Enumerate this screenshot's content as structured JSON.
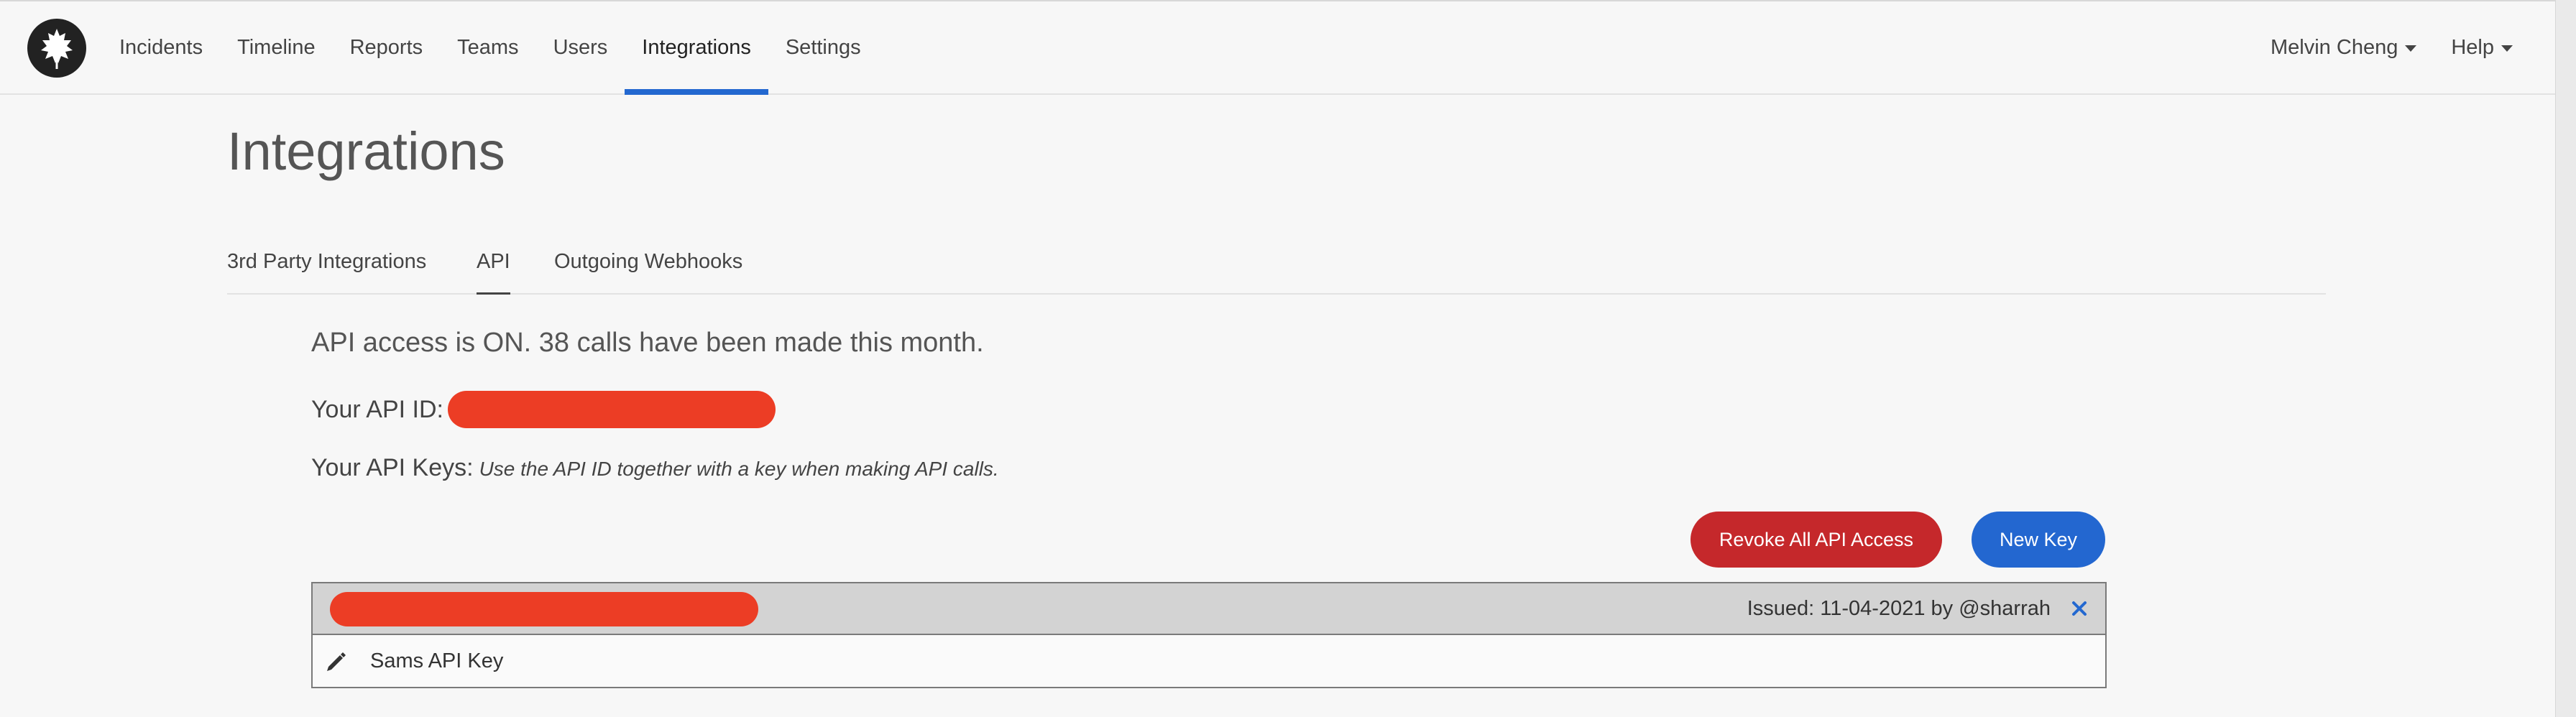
{
  "nav": {
    "items": [
      {
        "label": "Incidents",
        "active": false
      },
      {
        "label": "Timeline",
        "active": false
      },
      {
        "label": "Reports",
        "active": false
      },
      {
        "label": "Teams",
        "active": false
      },
      {
        "label": "Users",
        "active": false
      },
      {
        "label": "Integrations",
        "active": true
      },
      {
        "label": "Settings",
        "active": false
      }
    ],
    "user_menu_label": "Melvin Cheng",
    "help_menu_label": "Help",
    "accent_color": "#2368d0"
  },
  "page": {
    "title": "Integrations"
  },
  "subtabs": [
    {
      "label": "3rd Party Integrations",
      "active": false
    },
    {
      "label": "API",
      "active": true
    },
    {
      "label": "Outgoing Webhooks",
      "active": false
    }
  ],
  "api": {
    "status_text": "API access is ON. 38 calls have been made this month.",
    "api_id_label": "Your API ID:",
    "keys_label": "Your API Keys:",
    "keys_hint": "Use the API ID together with a key when making API calls.",
    "revoke_button_label": "Revoke All API Access",
    "new_key_button_label": "New Key",
    "revoke_color": "#c5282b",
    "new_key_color": "#2367d0",
    "redaction_color": "#ec3d25"
  },
  "keys": [
    {
      "issued_text": "Issued: 11-04-2021 by @sharrah",
      "name": "Sams API Key"
    }
  ],
  "icons": {
    "logo": "leaf-logo-icon",
    "edit": "pencil-icon",
    "remove": "close-icon",
    "dropdown": "caret-down-icon"
  }
}
